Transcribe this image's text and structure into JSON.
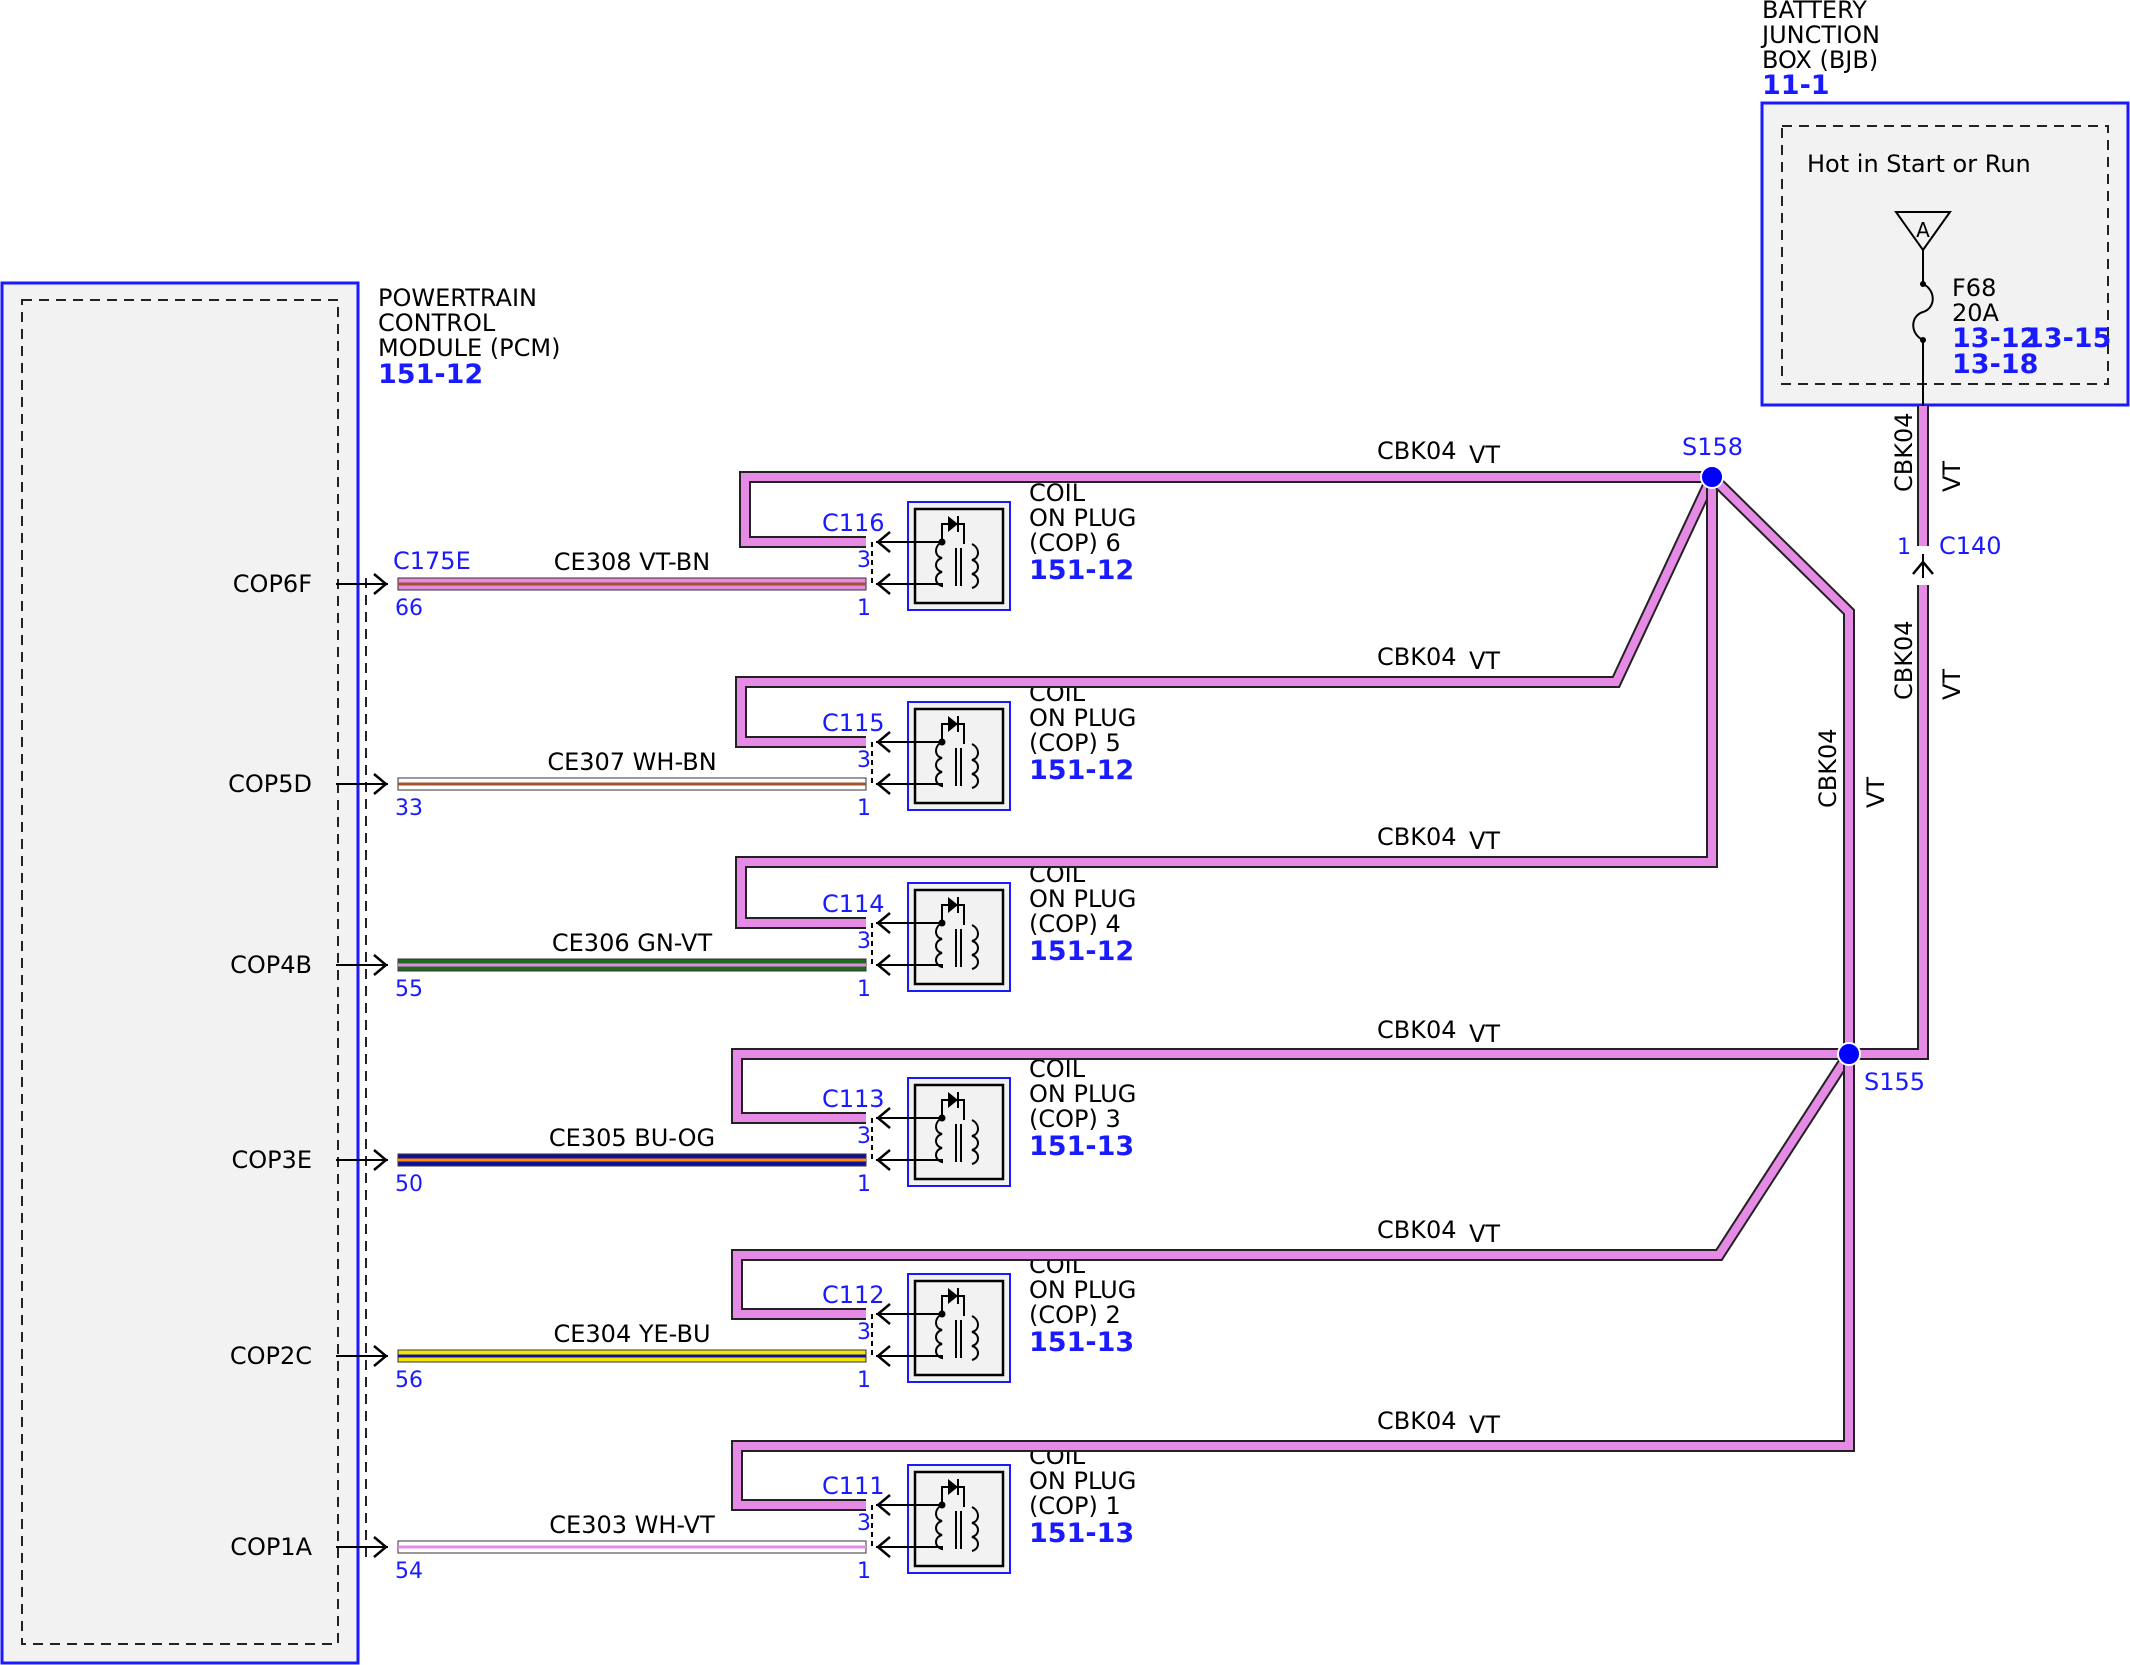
{
  "pcm": {
    "title_lines": [
      "POWERTRAIN",
      "CONTROL",
      "MODULE (PCM)"
    ],
    "ref": "151-12",
    "connector": "C175E"
  },
  "bjb": {
    "title_lines": [
      "BATTERY",
      "JUNCTION",
      "BOX (BJB)"
    ],
    "ref": "11-1",
    "hot_label": "Hot in Start or Run",
    "bus_label": "A",
    "fuse_name": "F68",
    "fuse_rating": "20A",
    "fuse_refs": [
      "13-12",
      "13-15",
      "13-18"
    ]
  },
  "splices": [
    "S158",
    "S155"
  ],
  "inline_connector": {
    "name": "C140",
    "pin": "1"
  },
  "feed_wire": {
    "circuit": "CBK04",
    "color": "VT"
  },
  "coils": [
    {
      "signal": "COP6F",
      "pcm_pin": "66",
      "circuit": "CE308 VT-BN",
      "connector": "C116",
      "pin_feed": "3",
      "pin_signal": "1",
      "name_lines": [
        "COIL",
        "ON PLUG",
        "(COP) 6"
      ],
      "ref": "151-12",
      "feed_label": "CBK04",
      "feed_color": "VT"
    },
    {
      "signal": "COP5D",
      "pcm_pin": "33",
      "circuit": "CE307 WH-BN",
      "connector": "C115",
      "pin_feed": "3",
      "pin_signal": "1",
      "name_lines": [
        "COIL",
        "ON PLUG",
        "(COP) 5"
      ],
      "ref": "151-12",
      "feed_label": "CBK04",
      "feed_color": "VT"
    },
    {
      "signal": "COP4B",
      "pcm_pin": "55",
      "circuit": "CE306 GN-VT",
      "connector": "C114",
      "pin_feed": "3",
      "pin_signal": "1",
      "name_lines": [
        "COIL",
        "ON PLUG",
        "(COP) 4"
      ],
      "ref": "151-12",
      "feed_label": "CBK04",
      "feed_color": "VT"
    },
    {
      "signal": "COP3E",
      "pcm_pin": "50",
      "circuit": "CE305 BU-OG",
      "connector": "C113",
      "pin_feed": "3",
      "pin_signal": "1",
      "name_lines": [
        "COIL",
        "ON PLUG",
        "(COP) 3"
      ],
      "ref": "151-13",
      "feed_label": "CBK04",
      "feed_color": "VT"
    },
    {
      "signal": "COP2C",
      "pcm_pin": "56",
      "circuit": "CE304 YE-BU",
      "connector": "C112",
      "pin_feed": "3",
      "pin_signal": "1",
      "name_lines": [
        "COIL",
        "ON PLUG",
        "(COP) 2"
      ],
      "ref": "151-13",
      "feed_label": "CBK04",
      "feed_color": "VT"
    },
    {
      "signal": "COP1A",
      "pcm_pin": "54",
      "circuit": "CE303 WH-VT",
      "connector": "C111",
      "pin_feed": "3",
      "pin_signal": "1",
      "name_lines": [
        "COIL",
        "ON PLUG",
        "(COP) 1"
      ],
      "ref": "151-13",
      "feed_label": "CBK04",
      "feed_color": "VT"
    }
  ],
  "wire_colors": {
    "violet": "#e58be5",
    "white": "#ffffff",
    "brown": "#a0522d",
    "green": "#1f6b1f",
    "blue": "#1010a0",
    "orange": "#ff8c00",
    "yellow": "#f2e600",
    "splice": "#0000ff",
    "outline": "#1a1aff"
  }
}
